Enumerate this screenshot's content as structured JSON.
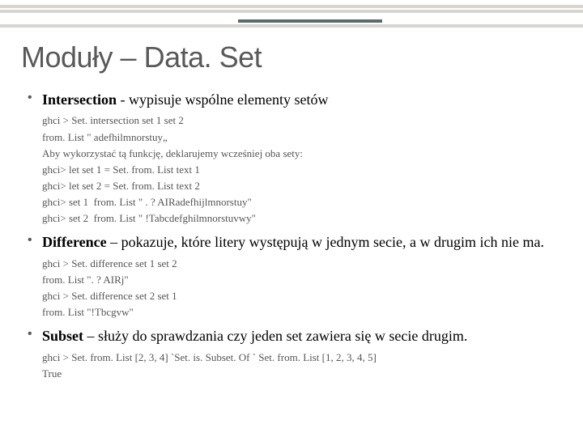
{
  "title": "Moduły – Data. Set",
  "bullets": [
    {
      "term": "Intersection",
      "sep": "-",
      "desc": "wypisuje wspólne elementy setów",
      "code": [
        "ghci > Set. intersection set 1 set 2",
        "from. List \" adefhilmnorstuy„",
        "Aby wykorzystać tą funkcję, deklarujemy wcześniej oba sety:",
        "ghci> let set 1 = Set. from. List text 1",
        "ghci> let set 2 = Set. from. List text 2",
        "ghci> set 1  from. List \" . ? AIRadefhijlmnorstuy\"",
        "ghci> set 2  from. List \" !Tabcdefghilmnorstuvwy\""
      ]
    },
    {
      "term": "Difference",
      "sep": "–",
      "desc": "pokazuje, które litery występują w jednym secie, a w drugim ich nie ma.",
      "code": [
        "ghci > Set. difference set 1 set 2",
        "from. List \". ? AIRj\"",
        "ghci > Set. difference set 2 set 1",
        "from. List \"!Tbcgvw\""
      ]
    },
    {
      "term": "Subset",
      "sep": "–",
      "desc": "służy do sprawdzania czy jeden set zawiera się w secie drugim.",
      "code": [
        "ghci > Set. from. List [2, 3, 4] `Set. is. Subset. Of ` Set. from. List [1, 2, 3, 4, 5]",
        "True"
      ]
    }
  ]
}
